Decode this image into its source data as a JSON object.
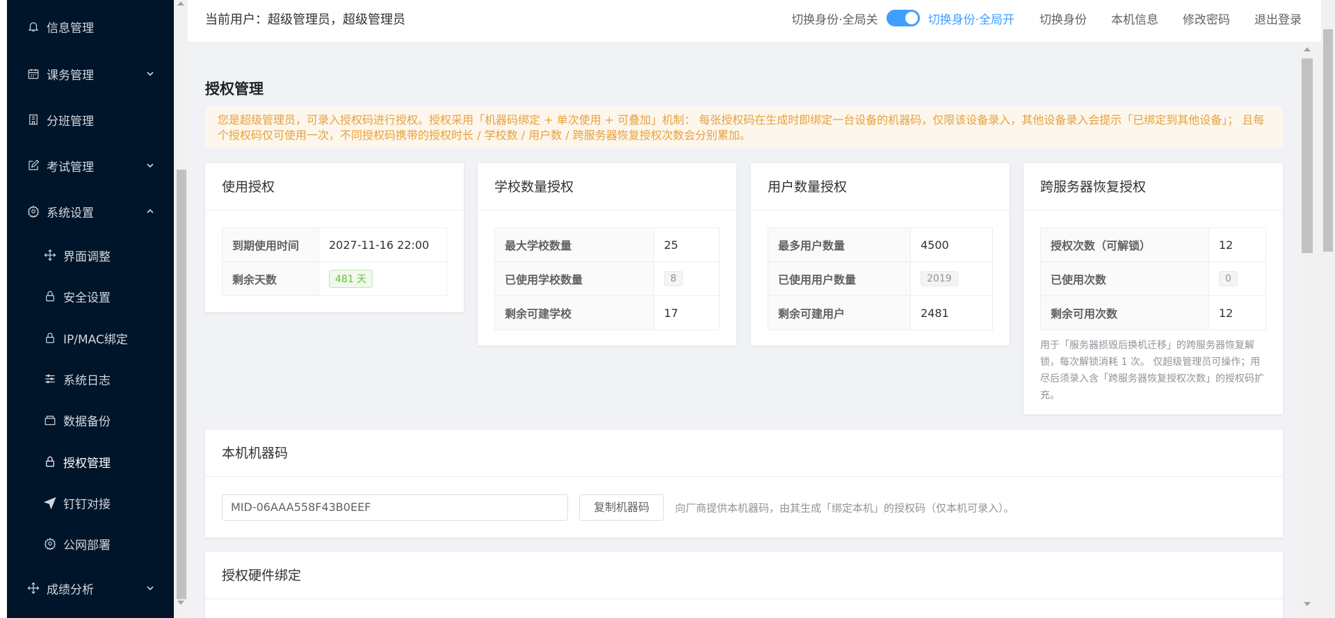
{
  "sidebar": {
    "items": [
      {
        "label": "信息管理",
        "icon": "bell-icon"
      },
      {
        "label": "课务管理",
        "icon": "calendar-icon"
      },
      {
        "label": "分班管理",
        "icon": "building-icon"
      },
      {
        "label": "考试管理",
        "icon": "edit-icon"
      },
      {
        "label": "系统设置",
        "icon": "gear-icon"
      },
      {
        "label": "界面调整",
        "icon": "move-icon"
      },
      {
        "label": "安全设置",
        "icon": "lock-icon"
      },
      {
        "label": "IP/MAC绑定",
        "icon": "lock-icon"
      },
      {
        "label": "系统日志",
        "icon": "sliders-icon"
      },
      {
        "label": "数据备份",
        "icon": "box-icon"
      },
      {
        "label": "授权管理",
        "icon": "lock-icon"
      },
      {
        "label": "钉钉对接",
        "icon": "send-icon"
      },
      {
        "label": "公网部署",
        "icon": "gear-icon"
      },
      {
        "label": "成绩分析",
        "icon": "move-icon"
      }
    ]
  },
  "header": {
    "current_user": "当前用户：超级管理员，超级管理员",
    "switch_off_label": "切换身份·全局关",
    "switch_on_label": "切换身份·全局开",
    "switch_identity": "切换身份",
    "machine_info": "本机信息",
    "change_password": "修改密码",
    "logout": "退出登录"
  },
  "page": {
    "title": "授权管理",
    "alert": "您是超级管理员，可录入授权码进行授权。授权采用「机器码绑定 + 单次使用 + 可叠加」机制： 每张授权码在生成时即绑定一台设备的机器码，仅限该设备录入，其他设备录入会提示「已绑定到其他设备」； 且每个授权码仅可使用一次，不同授权码携带的授权时长 / 学校数 / 用户数 / 跨服务器恢复授权次数会分别累加。"
  },
  "cards": {
    "usage": {
      "title": "使用授权",
      "rows": [
        {
          "k": "到期使用时间",
          "v": "2027-11-16 22:00"
        },
        {
          "k": "剩余天数",
          "v": "481 天"
        }
      ]
    },
    "school": {
      "title": "学校数量授权",
      "rows": [
        {
          "k": "最大学校数量",
          "v": "25"
        },
        {
          "k": "已使用学校数量",
          "v": "8"
        },
        {
          "k": "剩余可建学校",
          "v": "17"
        }
      ]
    },
    "user": {
      "title": "用户数量授权",
      "rows": [
        {
          "k": "最多用户数量",
          "v": "4500"
        },
        {
          "k": "已使用用户数量",
          "v": "2019"
        },
        {
          "k": "剩余可建用户",
          "v": "2481"
        }
      ]
    },
    "restore": {
      "title": "跨服务器恢复授权",
      "rows": [
        {
          "k": "授权次数（可解锁）",
          "v": "12"
        },
        {
          "k": "已使用次数",
          "v": "0"
        },
        {
          "k": "剩余可用次数",
          "v": "12"
        }
      ],
      "note": "用于「服务器损毁后换机迁移」的跨服务器恢复解锁，每次解锁消耗 1 次。 仅超级管理员可操作；用尽后须录入含「跨服务器恢复授权次数」的授权码扩充。"
    },
    "machine": {
      "title": "本机机器码",
      "code": "MID-06AAA558F43B0EEF",
      "copy_button": "复制机器码",
      "tip": "向厂商提供本机器码，由其生成「绑定本机」的授权码（仅本机可录入）。"
    },
    "hardware": {
      "title": "授权硬件绑定"
    }
  },
  "colors": {
    "sidebar_bg": "#001529",
    "accent": "#409eff",
    "warning": "#e6a23c",
    "success": "#67c23a"
  }
}
